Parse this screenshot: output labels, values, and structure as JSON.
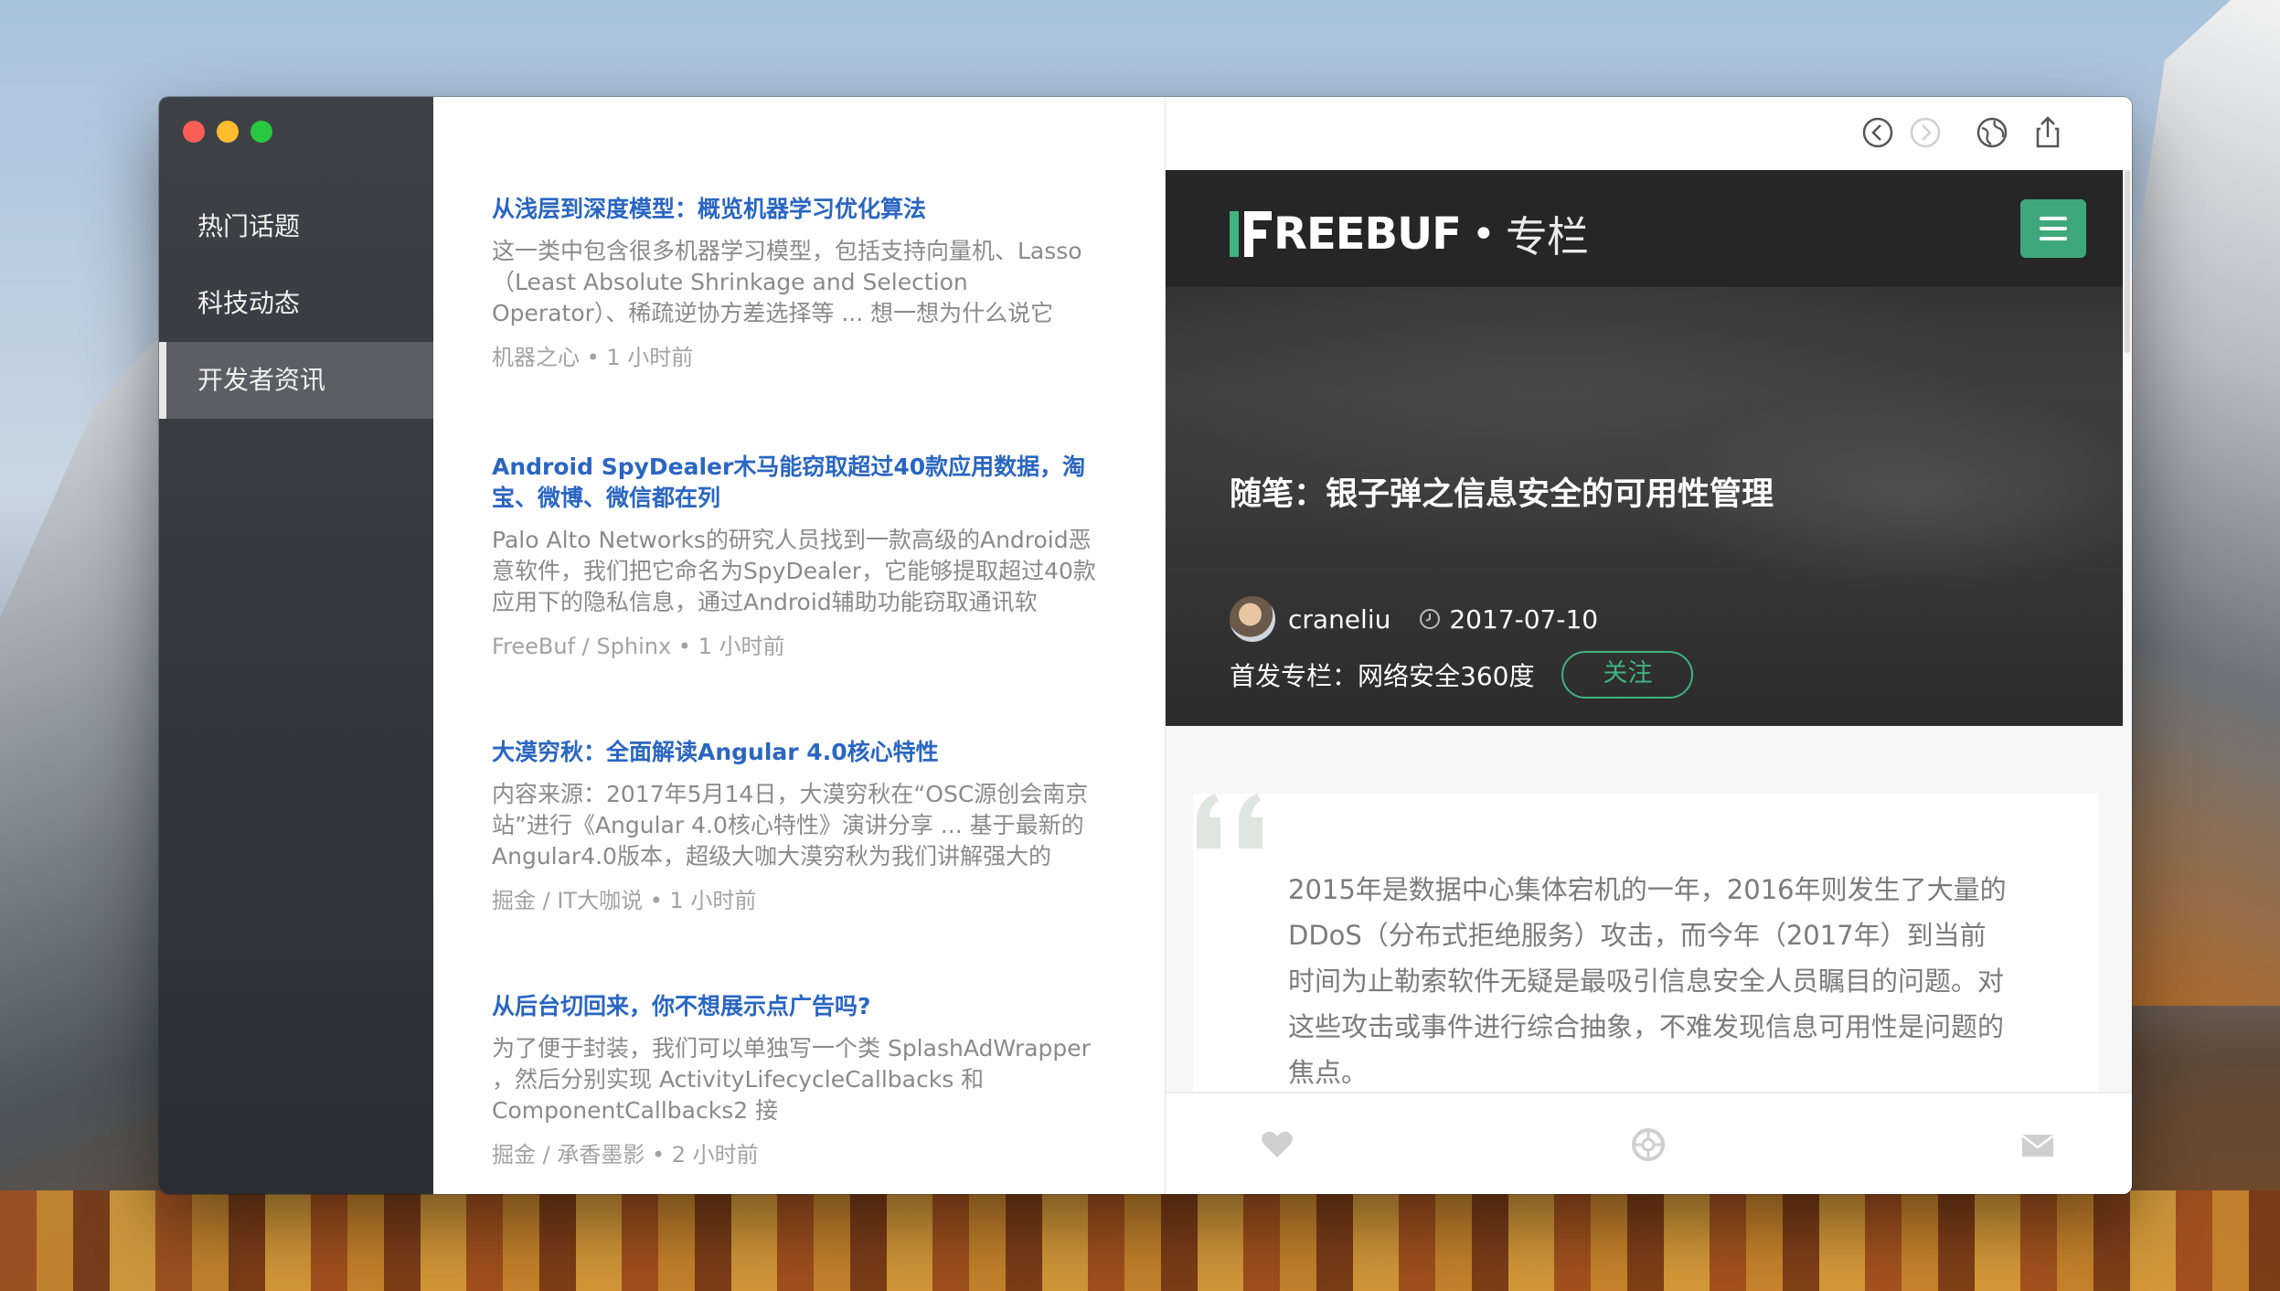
{
  "sidebar": {
    "items": [
      {
        "label": "热门话题"
      },
      {
        "label": "科技动态"
      },
      {
        "label": "开发者资讯"
      }
    ]
  },
  "articles": [
    {
      "title": "从浅层到深度模型：概览机器学习优化算法",
      "summary": "这一类中包含很多机器学习模型，包括支持向量机、Lasso（Least Absolute Shrinkage and Selection Operator）、稀疏逆协方差选择等 ... 想一想为什么说它",
      "meta": "机器之心 • 1 小时前"
    },
    {
      "title": "Android SpyDealer木马能窃取超过40款应用数据，淘宝、微博、微信都在列",
      "summary": "Palo Alto Networks的研究人员找到一款高级的Android恶意软件，我们把它命名为SpyDealer，它能够提取超过40款应用下的隐私信息，通过Android辅助功能窃取通讯软",
      "meta": "FreeBuf / Sphinx • 1 小时前"
    },
    {
      "title": "大漠穷秋：全面解读Angular 4.0核心特性",
      "summary": "内容来源：2017年5月14日，大漠穷秋在“OSC源创会南京站”进行《Angular 4.0核心特性》演讲分享 ... 基于最新的Angular4.0版本，超级大咖大漠穷秋为我们讲解强大的",
      "meta": "掘金 / IT大咖说 • 1 小时前"
    },
    {
      "title": "从后台切回来，你不想展示点广告吗?",
      "summary": "为了便于封装，我们可以单独写一个类 SplashAdWrapper ，然后分别实现 ActivityLifecycleCallbacks 和 ComponentCallbacks2 接",
      "meta": "掘金 / 承香墨影 • 2 小时前"
    }
  ],
  "toolbar": {
    "back_icon": "back-arrow-icon",
    "forward_icon": "forward-arrow-icon",
    "browser_icon": "globe-icon",
    "share_icon": "share-icon"
  },
  "detail": {
    "logo_text": "REEBUF",
    "logo_sep": "•",
    "logo_sub": "专栏",
    "title": "随笔：银子弹之信息安全的可用性管理",
    "author": "craneliu",
    "date": "2017-07-10",
    "column_label": "首发专栏：网络安全360度",
    "follow_label": "关注",
    "quote": "2015年是数据中心集体宕机的一年，2016年则发生了大量的DDoS（分布式拒绝服务）攻击，而今年（2017年）到当前时间为止勒索软件无疑是最吸引信息安全人员瞩目的问题。对这些攻击或事件进行综合抽象，不难发现信息可用性是问题的焦点。"
  },
  "colors": {
    "accent_green": "#3fb37c",
    "link_blue": "#2a66c2",
    "sidebar_bg": "#3a3e43"
  }
}
